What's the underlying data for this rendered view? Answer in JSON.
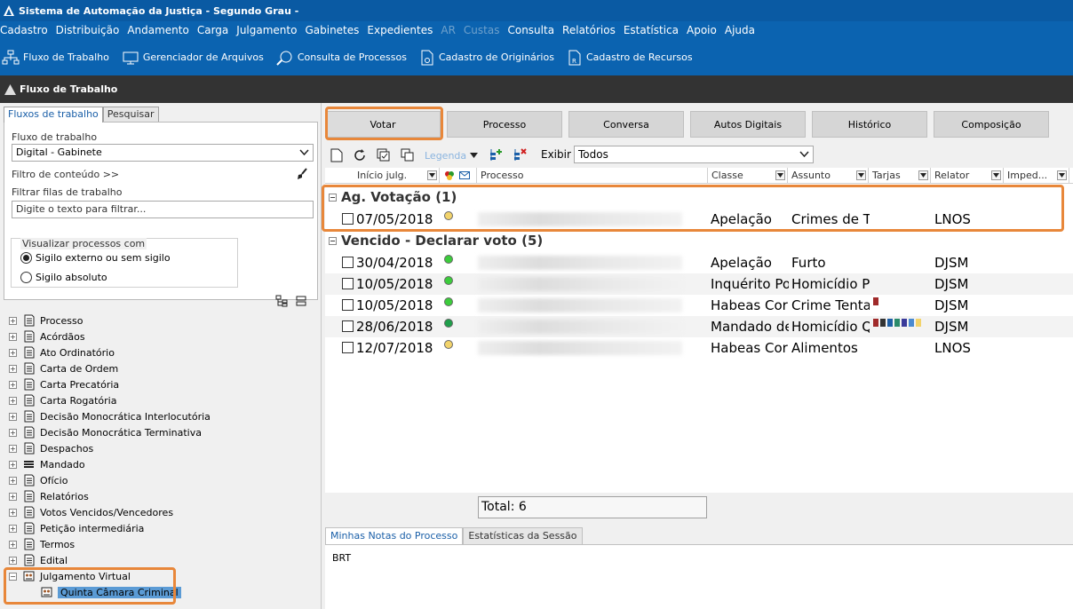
{
  "window": {
    "title": "Sistema de Automação da Justiça - Segundo Grau -"
  },
  "menu": [
    {
      "label": "Cadastro",
      "disabled": false
    },
    {
      "label": "Distribuição",
      "disabled": false
    },
    {
      "label": "Andamento",
      "disabled": false
    },
    {
      "label": "Carga",
      "disabled": false
    },
    {
      "label": "Julgamento",
      "disabled": false
    },
    {
      "label": "Gabinetes",
      "disabled": false
    },
    {
      "label": "Expedientes",
      "disabled": false
    },
    {
      "label": "AR",
      "disabled": true
    },
    {
      "label": "Custas",
      "disabled": true
    },
    {
      "label": "Consulta",
      "disabled": false
    },
    {
      "label": "Relatórios",
      "disabled": false
    },
    {
      "label": "Estatística",
      "disabled": false
    },
    {
      "label": "Apoio",
      "disabled": false
    },
    {
      "label": "Ajuda",
      "disabled": false
    }
  ],
  "toolbar": {
    "fluxo": "Fluxo de Trabalho",
    "arquivos": "Gerenciador de Arquivos",
    "consulta": "Consulta de Processos",
    "originarios": "Cadastro de Originários",
    "recursos": "Cadastro de Recursos"
  },
  "section_title": "Fluxo de Trabalho",
  "left": {
    "tabs": [
      "Fluxos de trabalho",
      "Pesquisar"
    ],
    "fluxo_label": "Fluxo de trabalho",
    "fluxo_value": "Digital - Gabinete",
    "filtro_conteudo": "Filtro de conteúdo >>",
    "filtrar_label": "Filtrar filas de trabalho",
    "filtrar_placeholder": "Digite o texto para filtrar...",
    "visualizar_label": "Visualizar processos com",
    "radio1": "Sigilo externo ou sem sigilo",
    "radio2": "Sigilo absoluto",
    "tree": [
      "Processo",
      "Acórdãos",
      "Ato Ordinatório",
      "Carta de Ordem",
      "Carta Precatória",
      "Carta Rogatória",
      "Decisão Monocrática Interlocutória",
      "Decisão Monocrática Terminativa",
      "Despachos",
      "Mandado",
      "Ofício",
      "Relatórios",
      "Votos Vencidos/Vencedores",
      "Petição intermediária",
      "Termos",
      "Edital"
    ],
    "tree_expanded": "Julgamento Virtual",
    "tree_child": "Quinta Câmara Criminal"
  },
  "right": {
    "buttons": [
      "Votar",
      "Processo",
      "Conversa",
      "Autos Digitais",
      "Histórico",
      "Composição"
    ],
    "legenda": "Legenda",
    "exibir_label": "Exibir",
    "exibir_value": "Todos",
    "columns": [
      "Início julg.",
      "Processo",
      "Classe",
      "Assunto",
      "Tarjas",
      "Relator",
      "Imped..."
    ],
    "groups": [
      {
        "title": "Ag. Votação (1)",
        "rows": [
          {
            "date": "07/05/2018",
            "status": "#f2d36b",
            "classe": "Apelação",
            "assunto": "Crimes de Tr",
            "relator": "LNOS",
            "tarjas": []
          }
        ]
      },
      {
        "title": "Vencido - Declarar voto (5)",
        "rows": [
          {
            "date": "30/04/2018",
            "status": "#3ccc3c",
            "classe": "Apelação",
            "assunto": "Furto",
            "relator": "DJSM",
            "tarjas": []
          },
          {
            "date": "10/05/2018",
            "status": "#3ccc3c",
            "classe": "Inquérito Pol",
            "assunto": "Homicídio Pr",
            "relator": "DJSM",
            "tarjas": []
          },
          {
            "date": "10/05/2018",
            "status": "#3ccc3c",
            "classe": "Habeas Corp",
            "assunto": "Crime Tentac",
            "relator": "DJSM",
            "tarjas": [
              "#a02a2a"
            ]
          },
          {
            "date": "28/06/2018",
            "status": "#1f9e4a",
            "classe": "Mandado de",
            "assunto": "Homicídio Q",
            "relator": "DJSM",
            "tarjas": [
              "#a02a2a",
              "#333333",
              "#1f5fa5",
              "#2a8a6a",
              "#3a3a9a",
              "#4a8ad0",
              "#f2d36b"
            ]
          },
          {
            "date": "12/07/2018",
            "status": "#f2d36b",
            "classe": "Habeas Corp",
            "assunto": "Alimentos",
            "relator": "LNOS",
            "tarjas": []
          }
        ]
      }
    ],
    "total": "Total: 6",
    "bottom_tabs": [
      "Minhas Notas do Processo",
      "Estatísticas da Sessão"
    ],
    "notes": "BRT"
  }
}
